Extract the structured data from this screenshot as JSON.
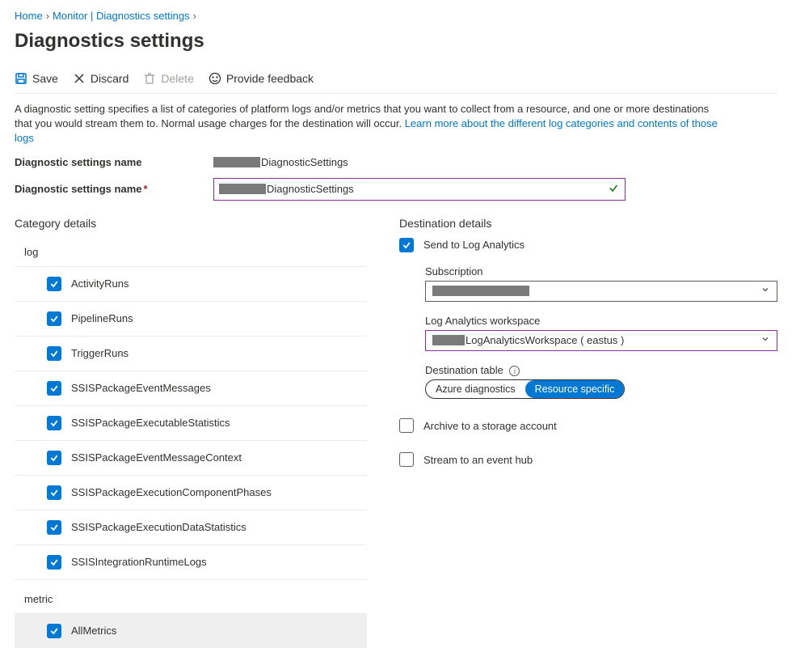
{
  "breadcrumb": {
    "home": "Home",
    "monitor": "Monitor | Diagnostics settings"
  },
  "page_title": "Diagnostics settings",
  "toolbar": {
    "save": "Save",
    "discard": "Discard",
    "delete": "Delete",
    "feedback": "Provide feedback"
  },
  "description": {
    "text": "A diagnostic setting specifies a list of categories of platform logs and/or metrics that you want to collect from a resource, and one or more destinations that you would stream them to. Normal usage charges for the destination will occur.",
    "link": "Learn more about the different log categories and contents of those logs"
  },
  "name1": {
    "label": "Diagnostic settings name",
    "suffix": "DiagnosticSettings"
  },
  "name2": {
    "label": "Diagnostic settings name",
    "suffix": "DiagnosticSettings"
  },
  "category": {
    "header": "Category details",
    "log": {
      "label": "log"
    },
    "metric": {
      "label": "metric"
    },
    "logs": [
      {
        "name": "ActivityRuns",
        "checked": true
      },
      {
        "name": "PipelineRuns",
        "checked": true
      },
      {
        "name": "TriggerRuns",
        "checked": true
      },
      {
        "name": "SSISPackageEventMessages",
        "checked": true
      },
      {
        "name": "SSISPackageExecutableStatistics",
        "checked": true
      },
      {
        "name": "SSISPackageEventMessageContext",
        "checked": true
      },
      {
        "name": "SSISPackageExecutionComponentPhases",
        "checked": true
      },
      {
        "name": "SSISPackageExecutionDataStatistics",
        "checked": true
      },
      {
        "name": "SSISIntegrationRuntimeLogs",
        "checked": true
      }
    ],
    "metrics": [
      {
        "name": "AllMetrics",
        "checked": true
      }
    ]
  },
  "destination": {
    "header": "Destination details",
    "send_la": "Send to Log Analytics",
    "subscription_label": "Subscription",
    "workspace_label": "Log Analytics workspace",
    "workspace_suffix": "LogAnalyticsWorkspace ( eastus )",
    "dest_table_label": "Destination table",
    "pill_azure": "Azure diagnostics",
    "pill_resource": "Resource specific",
    "archive": "Archive to a storage account",
    "stream": "Stream to an event hub"
  }
}
